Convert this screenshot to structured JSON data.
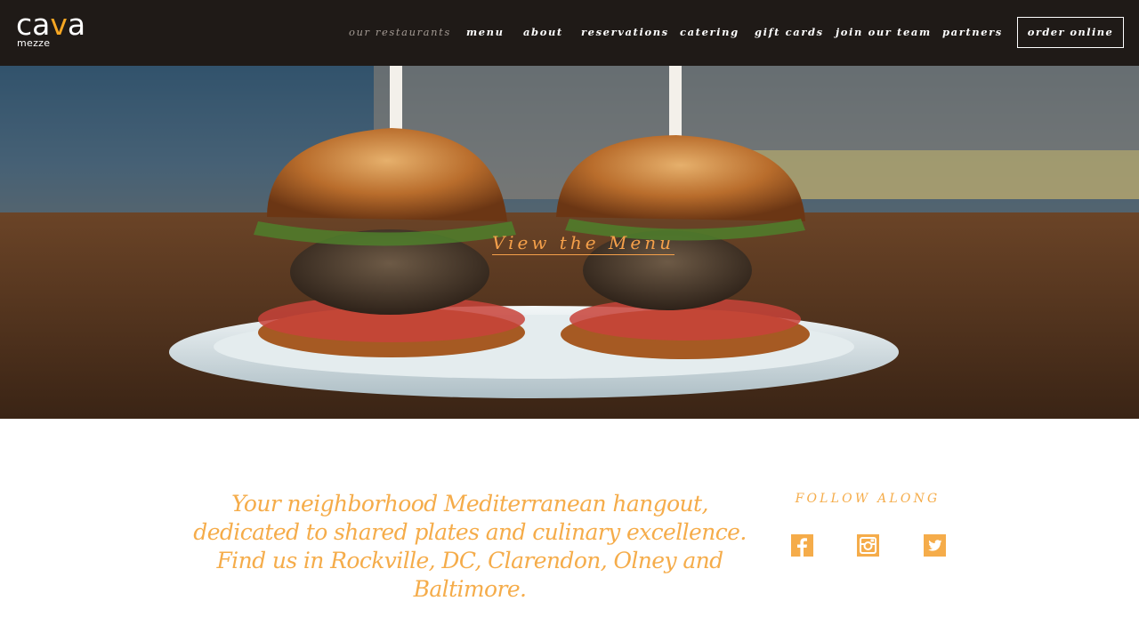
{
  "brand": {
    "logo_prefix": "ca",
    "logo_accent": "v",
    "logo_suffix": "a",
    "logo_sub": "mezze",
    "accent_color": "#f5a623"
  },
  "nav": {
    "items": [
      {
        "label": "our restaurants",
        "active": true
      },
      {
        "label": "menu"
      },
      {
        "label": "about"
      },
      {
        "label": "reservations"
      },
      {
        "label": "catering"
      },
      {
        "label": "gift cards"
      },
      {
        "label": "join our team"
      },
      {
        "label": "partners"
      }
    ],
    "order_online": "order online"
  },
  "hero": {
    "cta": "View the Menu"
  },
  "intro": {
    "tagline": "Your neighborhood Mediterranean hangout, dedicated to shared plates and culinary excellence. Find us in Rockville, DC, Clarendon, Olney and Baltimore."
  },
  "social": {
    "title": "FOLLOW ALONG",
    "icons": [
      "facebook-icon",
      "instagram-icon",
      "twitter-icon"
    ],
    "color": "#f5ac4a"
  }
}
